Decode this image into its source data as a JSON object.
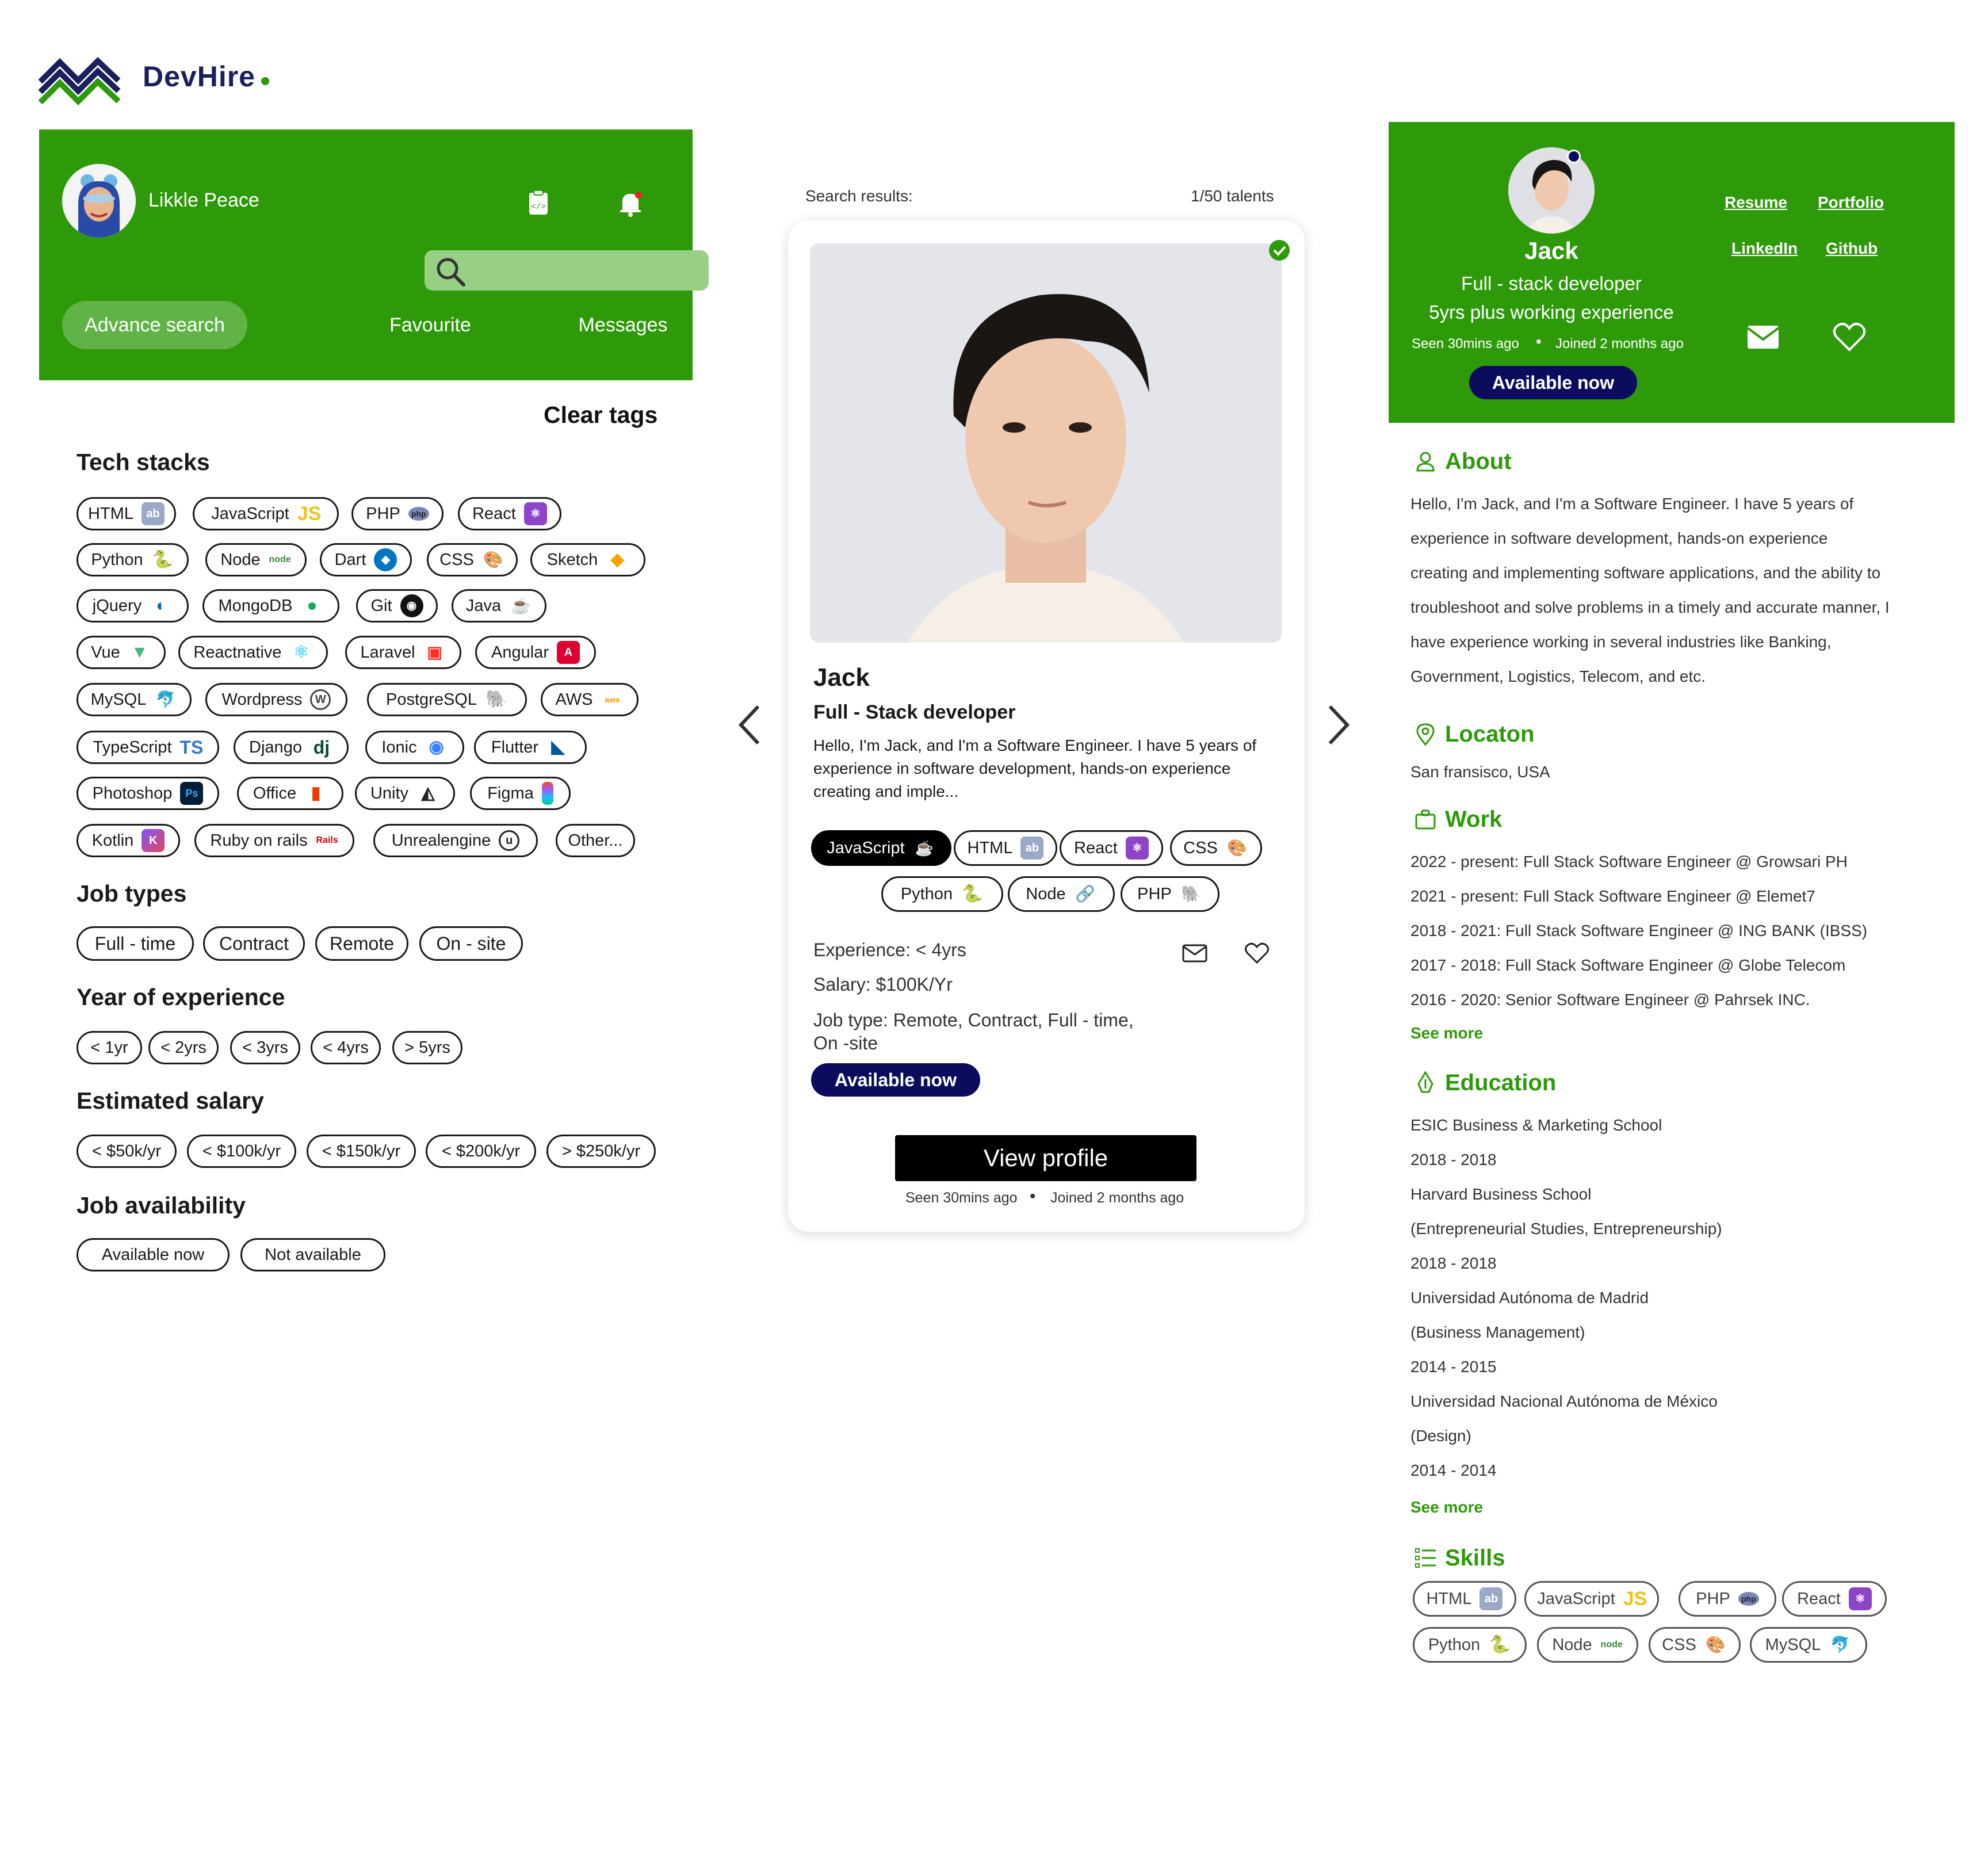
{
  "brand": {
    "name": "DevHire",
    "accent": "#2e9a0a",
    "navy": "#0c0c5e"
  },
  "left": {
    "user_name": "Likkle Peace",
    "search_placeholder": "",
    "nav": {
      "advance": "Advance search",
      "favourite": "Favourite",
      "messages": "Messages"
    },
    "clear_tags": "Clear tags",
    "tech_title": "Tech stacks",
    "tech": [
      "HTML",
      "JavaScript",
      "PHP",
      "React",
      "Python",
      "Node",
      "Dart",
      "CSS",
      "Sketch",
      "jQuery",
      "MongoDB",
      "Git",
      "Java",
      "Vue",
      "Reactnative",
      "Laravel",
      "Angular",
      "MySQL",
      "Wordpress",
      "PostgreSQL",
      "AWS",
      "TypeScript",
      "Django",
      "Ionic",
      "Flutter",
      "Photoshop",
      "Office",
      "Unity",
      "Figma",
      "Kotlin",
      "Ruby on rails",
      "Unrealengine",
      "Other..."
    ],
    "job_types_title": "Job types",
    "job_types": [
      "Full - time",
      "Contract",
      "Remote",
      "On - site"
    ],
    "exp_title": "Year of experience",
    "exp": [
      "< 1yr",
      "< 2yrs",
      "< 3yrs",
      "< 4yrs",
      "> 5yrs"
    ],
    "salary_title": "Estimated salary",
    "salary": [
      "< $50k/yr",
      "< $100k/yr",
      "< $150k/yr",
      "< $200k/yr",
      "> $250k/yr"
    ],
    "avail_title": "Job availability",
    "avail": [
      "Available now",
      "Not available"
    ]
  },
  "middle": {
    "results_label": "Search results:",
    "results_count": "1/50 talents",
    "name": "Jack",
    "role": "Full - Stack developer",
    "desc": "Hello, I'm Jack, and I'm a Software Engineer. I have 5 years of experience in software development, hands-on experience creating and imple...",
    "tags": [
      "JavaScript",
      "HTML",
      "React",
      "CSS",
      "Python",
      "Node",
      "PHP"
    ],
    "experience": "Experience: < 4yrs",
    "salary": "Salary: $100K/Yr",
    "job_type": "Job type: Remote, Contract, Full - time, On -site",
    "available": "Available now",
    "view_profile": "View profile",
    "seen": "Seen 30mins ago",
    "joined": "Joined 2 months ago"
  },
  "right": {
    "name": "Jack",
    "title": "Full - stack developer",
    "experience": "5yrs plus working experience",
    "seen": "Seen 30mins ago",
    "joined": "Joined 2 months ago",
    "available": "Available now",
    "links": {
      "resume": "Resume",
      "portfolio": "Portfolio",
      "linkedin": "LinkedIn",
      "github": "Github"
    },
    "about_title": "About",
    "about_lines": [
      "Hello, I'm Jack, and I'm a Software Engineer. I have 5 years of",
      "experience in software development, hands-on experience",
      "creating and implementing software applications, and the ability to",
      "troubleshoot and solve problems in a timely and accurate manner, I",
      "have experience working in several industries like Banking,",
      "Government, Logistics, Telecom, and etc."
    ],
    "location_title": "Locaton",
    "location": "San fransisco, USA",
    "work_title": "Work",
    "work": [
      "2022 - present: Full Stack Software Engineer @ Growsari PH",
      "2021 - present: Full Stack Software Engineer @ Elemet7",
      "2018 - 2021: Full Stack Software Engineer @ ING BANK (IBSS)",
      "2017 - 2018: Full Stack Software Engineer @ Globe Telecom",
      "2016 - 2020: Senior Software Engineer @ Pahrsek INC."
    ],
    "see_more": "See more",
    "education_title": "Education",
    "education": [
      "ESIC Business & Marketing School",
      "2018 - 2018",
      "Harvard Business School",
      "(Entrepreneurial Studies, Entrepreneurship)",
      "2018 - 2018",
      "Universidad Autónoma de Madrid",
      "(Business Management)",
      "2014 - 2015",
      "Universidad Nacional Autónoma de México",
      "(Design)",
      "2014 - 2014"
    ],
    "skills_title": "Skills",
    "skills": [
      "HTML",
      "JavaScript",
      "PHP",
      "React",
      "Python",
      "Node",
      "CSS",
      "MySQL"
    ]
  }
}
